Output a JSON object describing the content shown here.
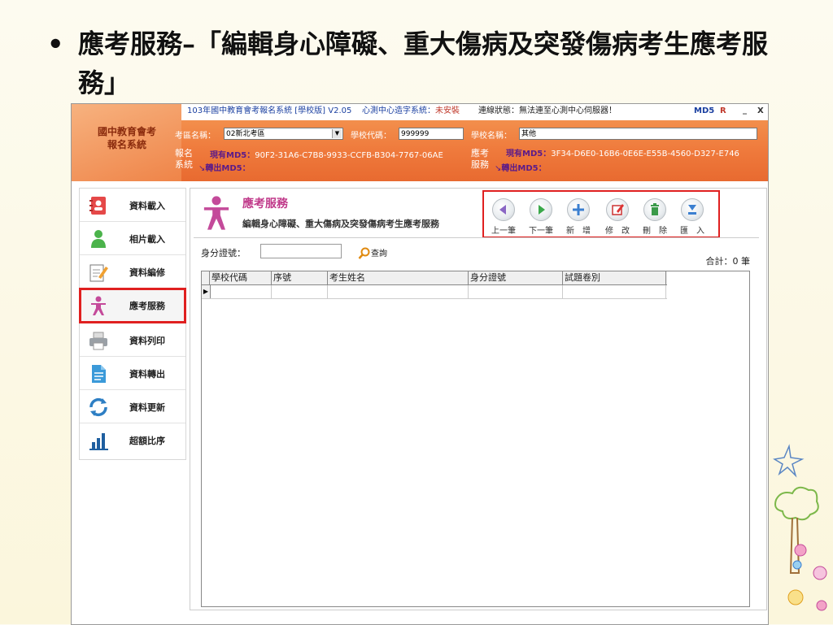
{
  "slide": {
    "bullet": "•",
    "title": "應考服務–「編輯身心障礙、重大傷病及突發傷病考生應考服務」"
  },
  "app": {
    "topbar": {
      "app_title": "103年國中教育會考報名系統 [學校版] V2.05",
      "center_status_label": "心測中心造字系統：",
      "center_status_value": "未安裝",
      "connection_status": "連線狀態：無法連至心測中心伺服器！",
      "md5": "MD5",
      "r": "R",
      "minimize": "_",
      "close": "X"
    },
    "logo": {
      "line1": "國中教育會考",
      "line2": "報名系統"
    },
    "header": {
      "exam_area_label": "考區名稱：",
      "exam_area_value": "02新北考區",
      "school_code_label": "學校代碼：",
      "school_code_value": "999999",
      "school_name_label": "學校名稱：",
      "school_name_value": "其他",
      "reg_system_label1": "報名",
      "reg_system_label2": "系統",
      "reg_current_md5_label": "現有MD5：",
      "reg_current_md5_value": "90F2-31A6-C7B8-9933-CCFB-B304-7767-06AE",
      "reg_export_md5_label": "轉出MD5：",
      "svc_label1": "應考",
      "svc_label2": "服務",
      "svc_current_md5_label": "現有MD5：",
      "svc_current_md5_value": "3F34-D6E0-16B6-0E6E-E55B-4560-D327-E746",
      "svc_export_md5_label": "轉出MD5："
    },
    "sidebar": {
      "items": [
        {
          "label": "資料載入",
          "icon": "address-book-icon"
        },
        {
          "label": "相片載入",
          "icon": "person-icon"
        },
        {
          "label": "資料編修",
          "icon": "edit-document-icon"
        },
        {
          "label": "應考服務",
          "icon": "accessibility-person-icon"
        },
        {
          "label": "資料列印",
          "icon": "printer-icon"
        },
        {
          "label": "資料轉出",
          "icon": "document-export-icon"
        },
        {
          "label": "資料更新",
          "icon": "refresh-icon"
        },
        {
          "label": "超額比序",
          "icon": "bar-chart-icon"
        }
      ],
      "active_index": 3
    },
    "panel": {
      "title": "應考服務",
      "subtitle": "編輯身心障礙、重大傷病及突發傷病考生應考服務",
      "toolbar": [
        {
          "label": "上一筆",
          "icon": "arrow-left-icon"
        },
        {
          "label": "下一筆",
          "icon": "arrow-right-icon"
        },
        {
          "label": "新　增",
          "icon": "plus-icon"
        },
        {
          "label": "修　改",
          "icon": "edit-icon"
        },
        {
          "label": "刪　除",
          "icon": "trash-icon"
        },
        {
          "label": "匯　入",
          "icon": "import-icon"
        }
      ],
      "id_label": "身分證號：",
      "id_value": "",
      "search_label": "查詢",
      "count_text": "合計：0 筆",
      "columns": [
        "學校代碼",
        "序號",
        "考生姓名",
        "身分證號",
        "試題卷別"
      ]
    }
  },
  "colors": {
    "accent_red": "#e02020",
    "header_orange": "#ef7a3c",
    "title_magenta": "#c0398a"
  }
}
